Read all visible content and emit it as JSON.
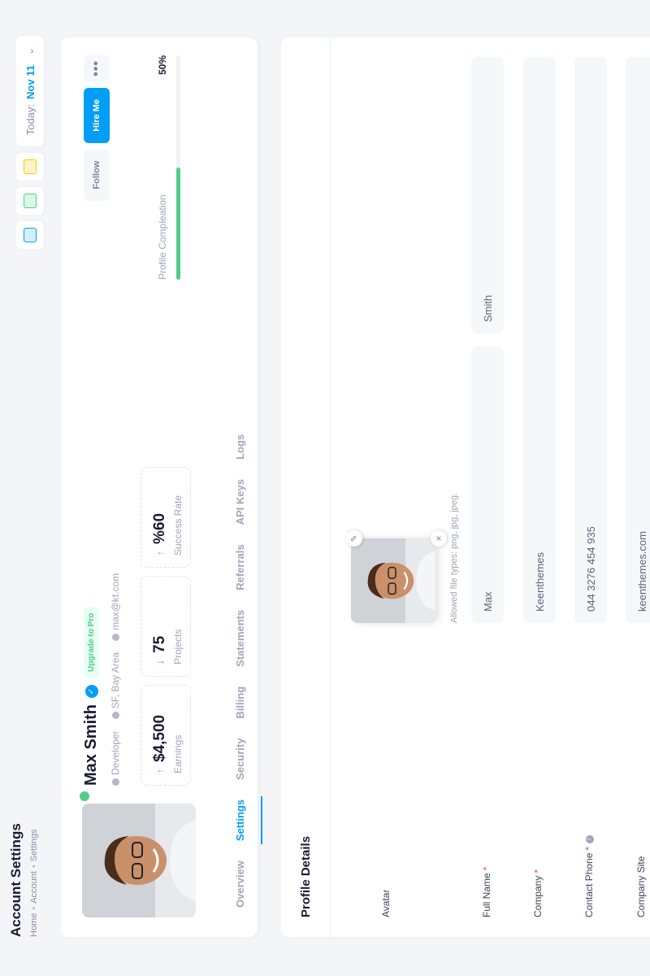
{
  "colors": {
    "primary": "#009ef7",
    "success": "#50cd89",
    "danger": "#f1416c"
  },
  "toolbar": {
    "title": "Account Settings",
    "breadcrumbs": [
      "Home",
      "Account",
      "Settings"
    ],
    "icons": [
      "code-icon",
      "add-file-icon",
      "chart-icon"
    ],
    "date_label": "Today:",
    "date_value": "Nov 11"
  },
  "profile": {
    "name": "Max Smith",
    "badge": "Upgrade to Pro",
    "role": "Developer",
    "location": "SF, Bay Area",
    "email": "max@kt.com",
    "stats": [
      {
        "value": "$4,500",
        "label": "Earnings",
        "trend": "up"
      },
      {
        "value": "75",
        "label": "Projects",
        "trend": "down"
      },
      {
        "value": "%60",
        "label": "Success Rate",
        "trend": "up"
      }
    ],
    "follow_label": "Follow",
    "hire_label": "Hire Me",
    "more_label": "•••",
    "completion_label": "Profile Compleation",
    "completion_value": "50%",
    "completion_fraction": 0.5
  },
  "tabs": [
    "Overview",
    "Settings",
    "Security",
    "Billing",
    "Statements",
    "Referrals",
    "API Keys",
    "Logs"
  ],
  "active_tab": 1,
  "details": {
    "title": "Profile Details",
    "avatar_label": "Avatar",
    "avatar_hint": "Allowed file types: png, jpg, jpeg.",
    "full_name_label": "Full Name",
    "first_name": "Max",
    "last_name": "Smith",
    "company_label": "Company",
    "company": "Keenthemes",
    "phone_label": "Contact Phone",
    "phone": "044 3276 454 935",
    "site_label": "Company Site",
    "site": "keenthemes.com"
  }
}
